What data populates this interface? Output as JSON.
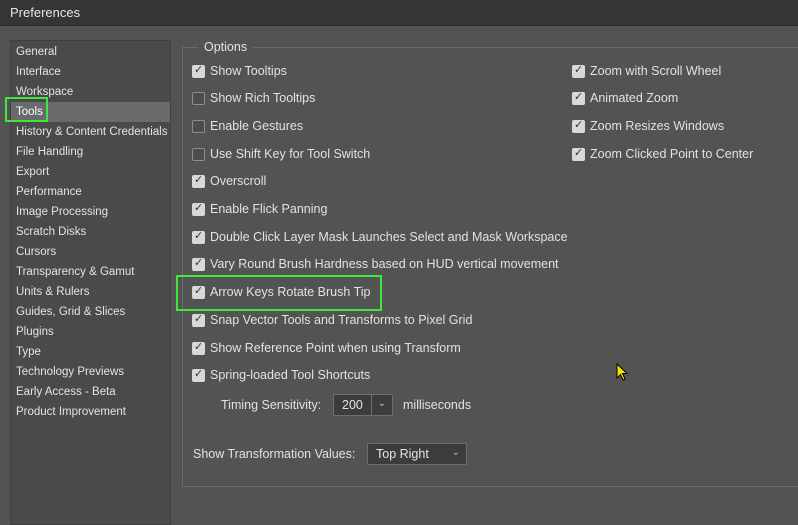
{
  "window": {
    "title": "Preferences"
  },
  "sidebar": {
    "items": [
      {
        "label": "General"
      },
      {
        "label": "Interface"
      },
      {
        "label": "Workspace"
      },
      {
        "label": "Tools",
        "selected": true
      },
      {
        "label": "History & Content Credentials"
      },
      {
        "label": "File Handling"
      },
      {
        "label": "Export"
      },
      {
        "label": "Performance"
      },
      {
        "label": "Image Processing"
      },
      {
        "label": "Scratch Disks"
      },
      {
        "label": "Cursors"
      },
      {
        "label": "Transparency & Gamut"
      },
      {
        "label": "Units & Rulers"
      },
      {
        "label": "Guides, Grid & Slices"
      },
      {
        "label": "Plugins"
      },
      {
        "label": "Type"
      },
      {
        "label": "Technology Previews"
      },
      {
        "label": "Early Access - Beta"
      },
      {
        "label": "Product Improvement"
      }
    ]
  },
  "options": {
    "legend": "Options",
    "left": [
      {
        "label": "Show Tooltips",
        "checked": true
      },
      {
        "label": "Show Rich Tooltips",
        "checked": false
      },
      {
        "label": "Enable Gestures",
        "checked": false
      },
      {
        "label": "Use Shift Key for Tool Switch",
        "checked": false
      },
      {
        "label": "Overscroll",
        "checked": true
      },
      {
        "label": "Enable Flick Panning",
        "checked": true
      },
      {
        "label": "Double Click Layer Mask Launches Select and Mask Workspace",
        "checked": true
      },
      {
        "label": "Vary Round Brush Hardness based on HUD vertical movement",
        "checked": true
      },
      {
        "label": "Arrow Keys Rotate Brush Tip",
        "checked": true
      },
      {
        "label": "Snap Vector Tools and Transforms to Pixel Grid",
        "checked": true
      },
      {
        "label": "Show Reference Point when using Transform",
        "checked": true
      },
      {
        "label": "Spring-loaded Tool Shortcuts",
        "checked": true
      }
    ],
    "right": [
      {
        "label": "Zoom with Scroll Wheel",
        "checked": true
      },
      {
        "label": "Animated Zoom",
        "checked": true
      },
      {
        "label": "Zoom Resizes Windows",
        "checked": true
      },
      {
        "label": "Zoom Clicked Point to Center",
        "checked": true
      }
    ],
    "timing": {
      "label": "Timing Sensitivity:",
      "value": "200",
      "unit": "milliseconds"
    },
    "transform": {
      "label": "Show Transformation Values:",
      "value": "Top Right"
    }
  },
  "colors": {
    "highlight": "#3ee63e",
    "background": "#535353",
    "sidebar": "#4a4a4a"
  }
}
